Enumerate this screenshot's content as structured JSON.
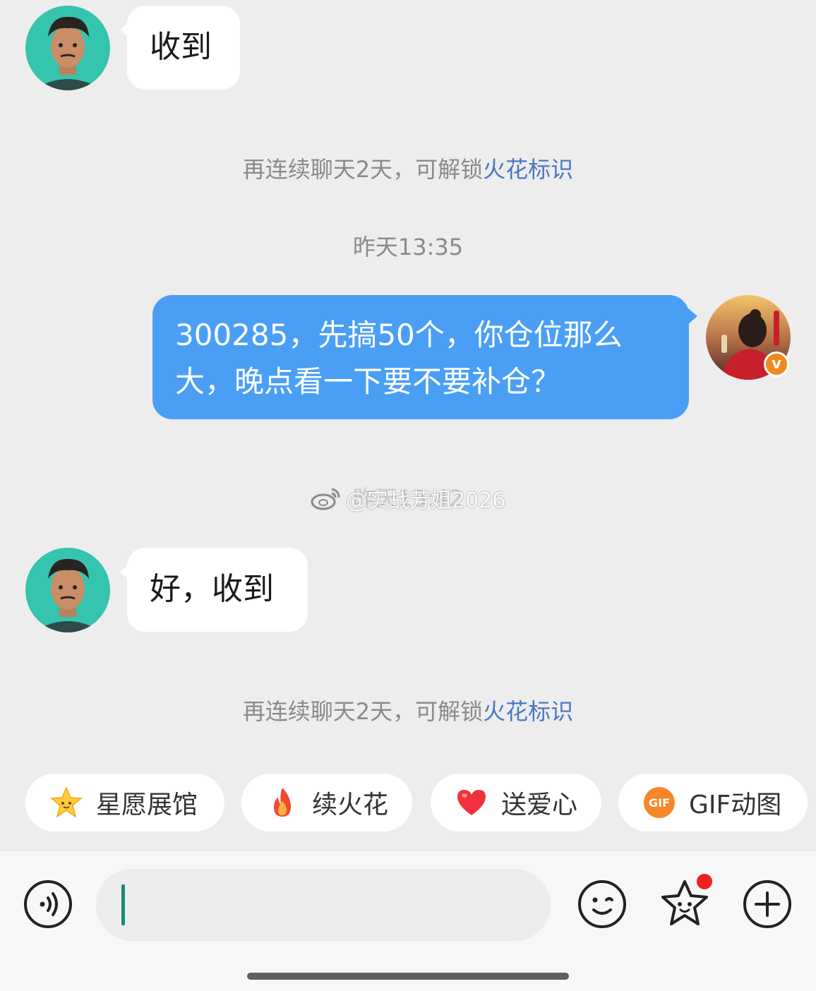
{
  "messages": [
    {
      "sender": "friend",
      "text": "收到"
    },
    {
      "sender": "self",
      "line1": "300285，先搞50个，你仓位那么",
      "line2": "大，晚点看一下要不要补仓？"
    },
    {
      "sender": "friend",
      "text": "好，收到"
    }
  ],
  "system": {
    "streak_prefix": "再连续聊天2天，可解锁",
    "streak_link": "火花标识",
    "timestamp_1": "昨天13:35",
    "timestamp_2_partial": "昨天13:42"
  },
  "watermark": "@实战芳姐2026",
  "quick_actions": [
    {
      "label": "星愿展馆",
      "icon": "star-face-icon"
    },
    {
      "label": "续火花",
      "icon": "flame-icon"
    },
    {
      "label": "送爱心",
      "icon": "heart-icon"
    },
    {
      "label": "GIF动图",
      "icon": "gif-icon"
    }
  ],
  "input": {
    "value": ""
  },
  "colors": {
    "background": "#ededed",
    "self_bubble": "#4a9ff5",
    "friend_bubble": "#ffffff",
    "link": "#4a78c2",
    "notification_dot": "#f02020",
    "verified_badge": "#f08a1c"
  }
}
